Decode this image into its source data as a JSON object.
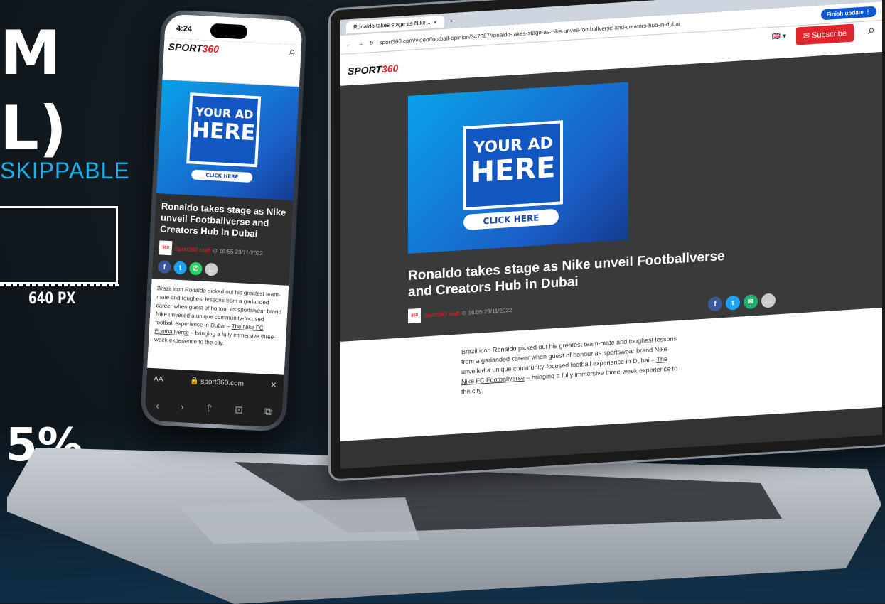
{
  "left_panel": {
    "line1": "M",
    "line2": "L)",
    "skippable": "SKIPPABLE",
    "width_label": "640 PX",
    "percent": "5%"
  },
  "phone": {
    "time": "4:24",
    "logo_prefix": "SPORT",
    "logo_suffix": "360",
    "ad_line1": "YOUR AD",
    "ad_line2": "HERE",
    "ad_button": "CLICK HERE",
    "title": "Ronaldo takes stage as Nike unveil Footballverse and Creators Hub in Dubai",
    "author": "Sport360 staff",
    "date": "⊙ 16:55 23/11/2022",
    "body_text": "Brazil icon Ronaldo picked out his greatest team-mate and toughest lessons from a garlanded career when guest of honour as sportswear brand Nike unveiled a unique community-focused football experience in Dubai – ",
    "body_link": "The Nike FC Footballverse",
    "body_tail": " – bringing a fully immersive three-week experience to the city.",
    "url_aa": "AA",
    "url": "🔒 sport360.com",
    "url_close": "✕",
    "nav": [
      "‹",
      "›",
      "⇧",
      "⊡",
      "⧉"
    ]
  },
  "laptop": {
    "tab_title": "Ronaldo takes stage as Nike ... ×",
    "new_tab": "+",
    "url": "sport360.com/video/football-opinion/347687/ronaldo-takes-stage-as-nike-unveil-footballverse-and-creators-hub-in-dubai",
    "finish_update": "Finish update ⋮",
    "logo_prefix": "SPORT",
    "logo_suffix": "360",
    "lang": "🇬🇧 ▾",
    "subscribe": "✉ Subscribe",
    "ad_line1": "YOUR AD",
    "ad_line2": "HERE",
    "ad_button": "CLICK HERE",
    "title": "Ronaldo takes stage as Nike unveil Footballverse and Creators Hub in Dubai",
    "author": "Sport360 staff",
    "date": "⊙ 16:55 23/11/2022",
    "body_text": "Brazil icon Ronaldo picked out his greatest team-mate and toughest lessons from a garlanded career when guest of honour as sportswear brand Nike unveiled a unique community-focused football experience in Dubai – ",
    "body_link": "The Nike FC Footballverse",
    "body_tail": " – bringing a fully immersive three-week experience to the city."
  },
  "colors": {
    "facebook": "#3b5998",
    "twitter": "#1da1f2",
    "whatsapp": "#25d366",
    "email": "#20b070",
    "more": "#cccccc",
    "brand_red": "#e0262d"
  }
}
